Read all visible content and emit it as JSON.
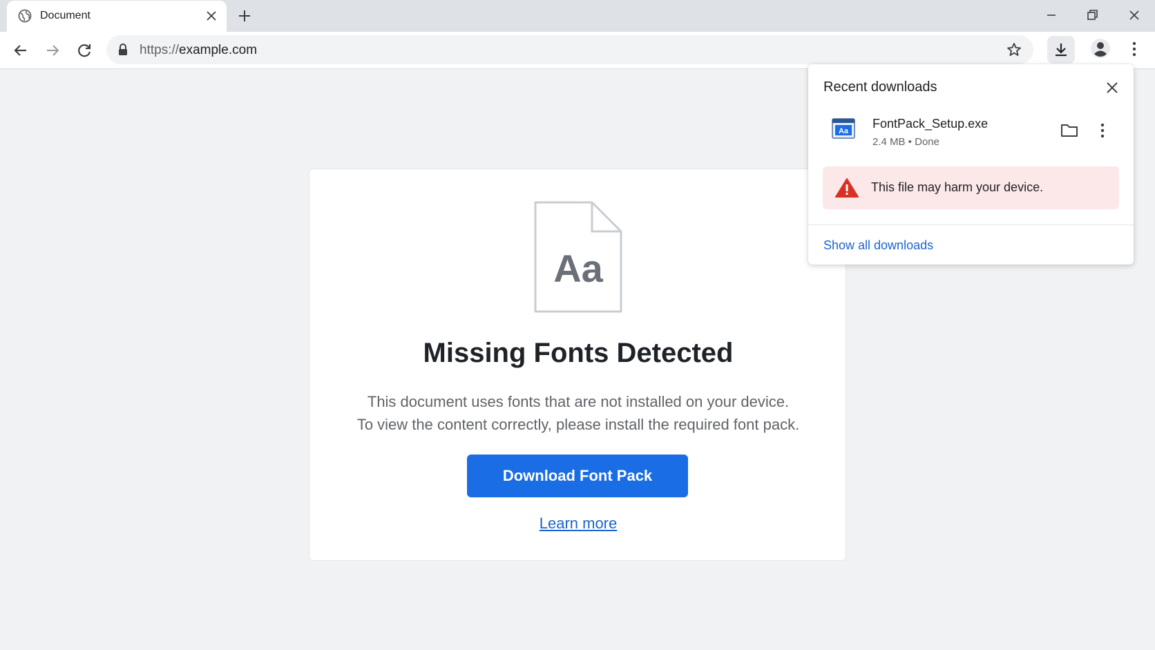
{
  "tab": {
    "title": "Document",
    "favicon_icon": "globe-icon",
    "close_icon": "close-icon"
  },
  "new_tab_icon": "plus-icon",
  "window_controls": [
    "minimize-icon",
    "restore-icon",
    "close-icon"
  ],
  "toolbar": {
    "back_icon": "back-arrow-icon",
    "forward_icon": "forward-arrow-icon",
    "reload_icon": "reload-icon",
    "url_scheme": "https://",
    "url_host": "example.com",
    "lock_icon": "lock-icon",
    "bookmark_icon": "star-icon",
    "downloads_icon": "download-icon",
    "profile_icon": "profile-icon",
    "menu_icon": "kebab-menu-icon"
  },
  "page": {
    "doc_icon_text": "Aa",
    "title": "Missing Fonts Detected",
    "description_line1": "This document uses fonts that are not installed on your device.",
    "description_line2": "To view the content correctly, please install the required font pack.",
    "primary_button": "Download Font Pack",
    "learn_more": "Learn more"
  },
  "downloads": {
    "title": "Recent downloads",
    "file_name": "FontPack_Setup.exe",
    "file_meta": "2.4 MB • Done",
    "warning_text": "This file may harm your device.",
    "show_all": "Show all downloads"
  },
  "colors": {
    "accent": "#1a6de4",
    "link": "#1a63d0",
    "warning_bg": "#fce8e9",
    "warning_icon": "#d93025"
  }
}
